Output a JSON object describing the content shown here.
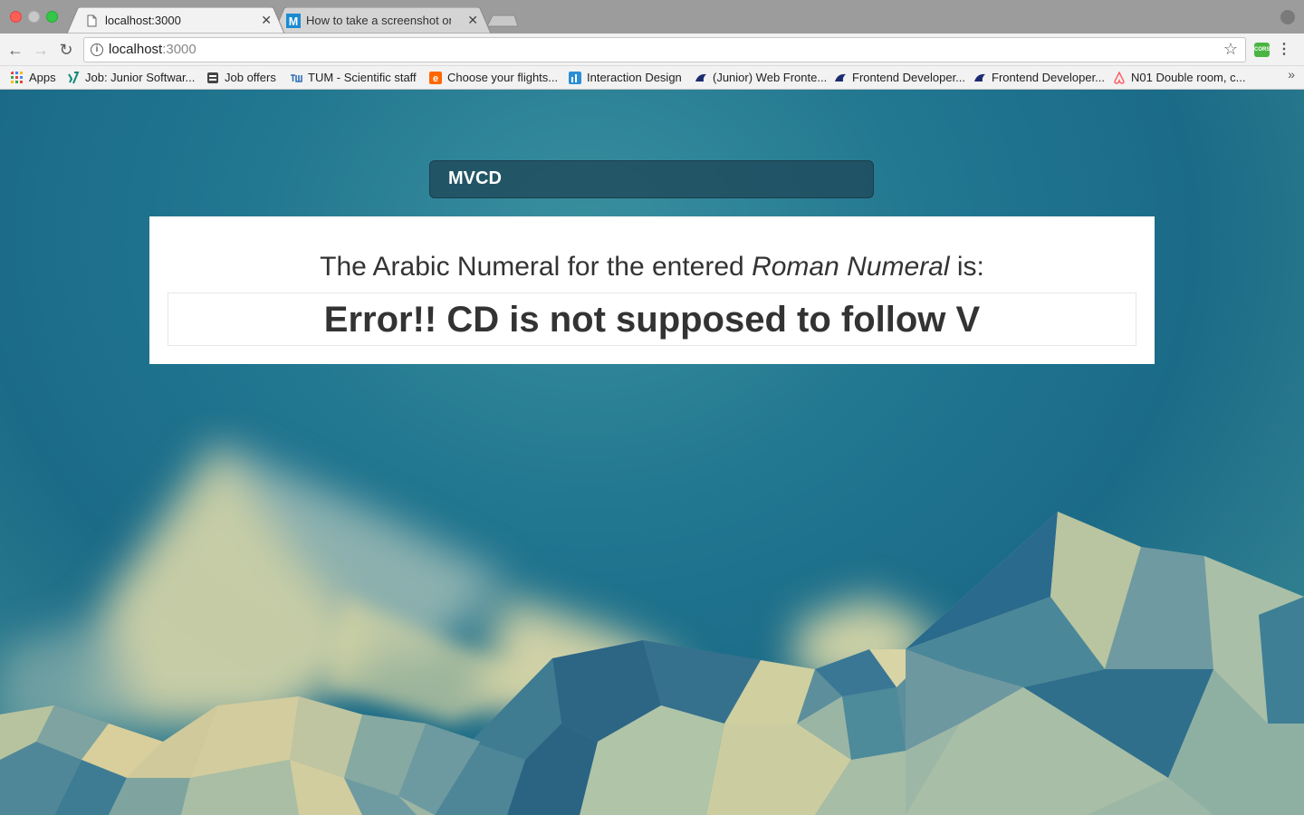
{
  "browser": {
    "tabs": [
      {
        "title": "localhost:3000",
        "close": "✕",
        "icon": "page-icon"
      },
      {
        "title": "How to take a screenshot on M",
        "close": "✕",
        "icon": "medium-icon"
      }
    ],
    "address": {
      "host": "localhost",
      "port": ":3000"
    },
    "bookmarks": [
      {
        "label": "Apps",
        "icon": "apps-grid-icon",
        "color": "#e94235"
      },
      {
        "label": "Job: Junior Softwar...",
        "icon": "xing-icon",
        "color": "#0a8a74"
      },
      {
        "label": "Job offers",
        "icon": "stackexchange-icon",
        "color": "#444444"
      },
      {
        "label": "TUM - Scientific staff",
        "icon": "tum-icon",
        "color": "#2f6fb7"
      },
      {
        "label": "Choose your flights...",
        "icon": "easyjet-icon",
        "color": "#ff6600"
      },
      {
        "label": "Interaction Design",
        "icon": "ixd-icon",
        "color": "#2a8fd6"
      },
      {
        "label": "(Junior) Web Fronte...",
        "icon": "stepstone-icon",
        "color": "#1b2c6f"
      },
      {
        "label": "Frontend Developer...",
        "icon": "stepstone-icon",
        "color": "#1b2c6f"
      },
      {
        "label": "Frontend Developer...",
        "icon": "stepstone-icon",
        "color": "#1b2c6f"
      },
      {
        "label": "N01 Double room, c...",
        "icon": "airbnb-icon",
        "color": "#ff5a5f"
      }
    ]
  },
  "app": {
    "input_value": "MVCD",
    "heading_prefix": "The Arabic Numeral for the entered ",
    "heading_emphasis": "Roman Numeral",
    "heading_suffix": " is:",
    "result": "Error!! CD is not supposed to follow V"
  }
}
